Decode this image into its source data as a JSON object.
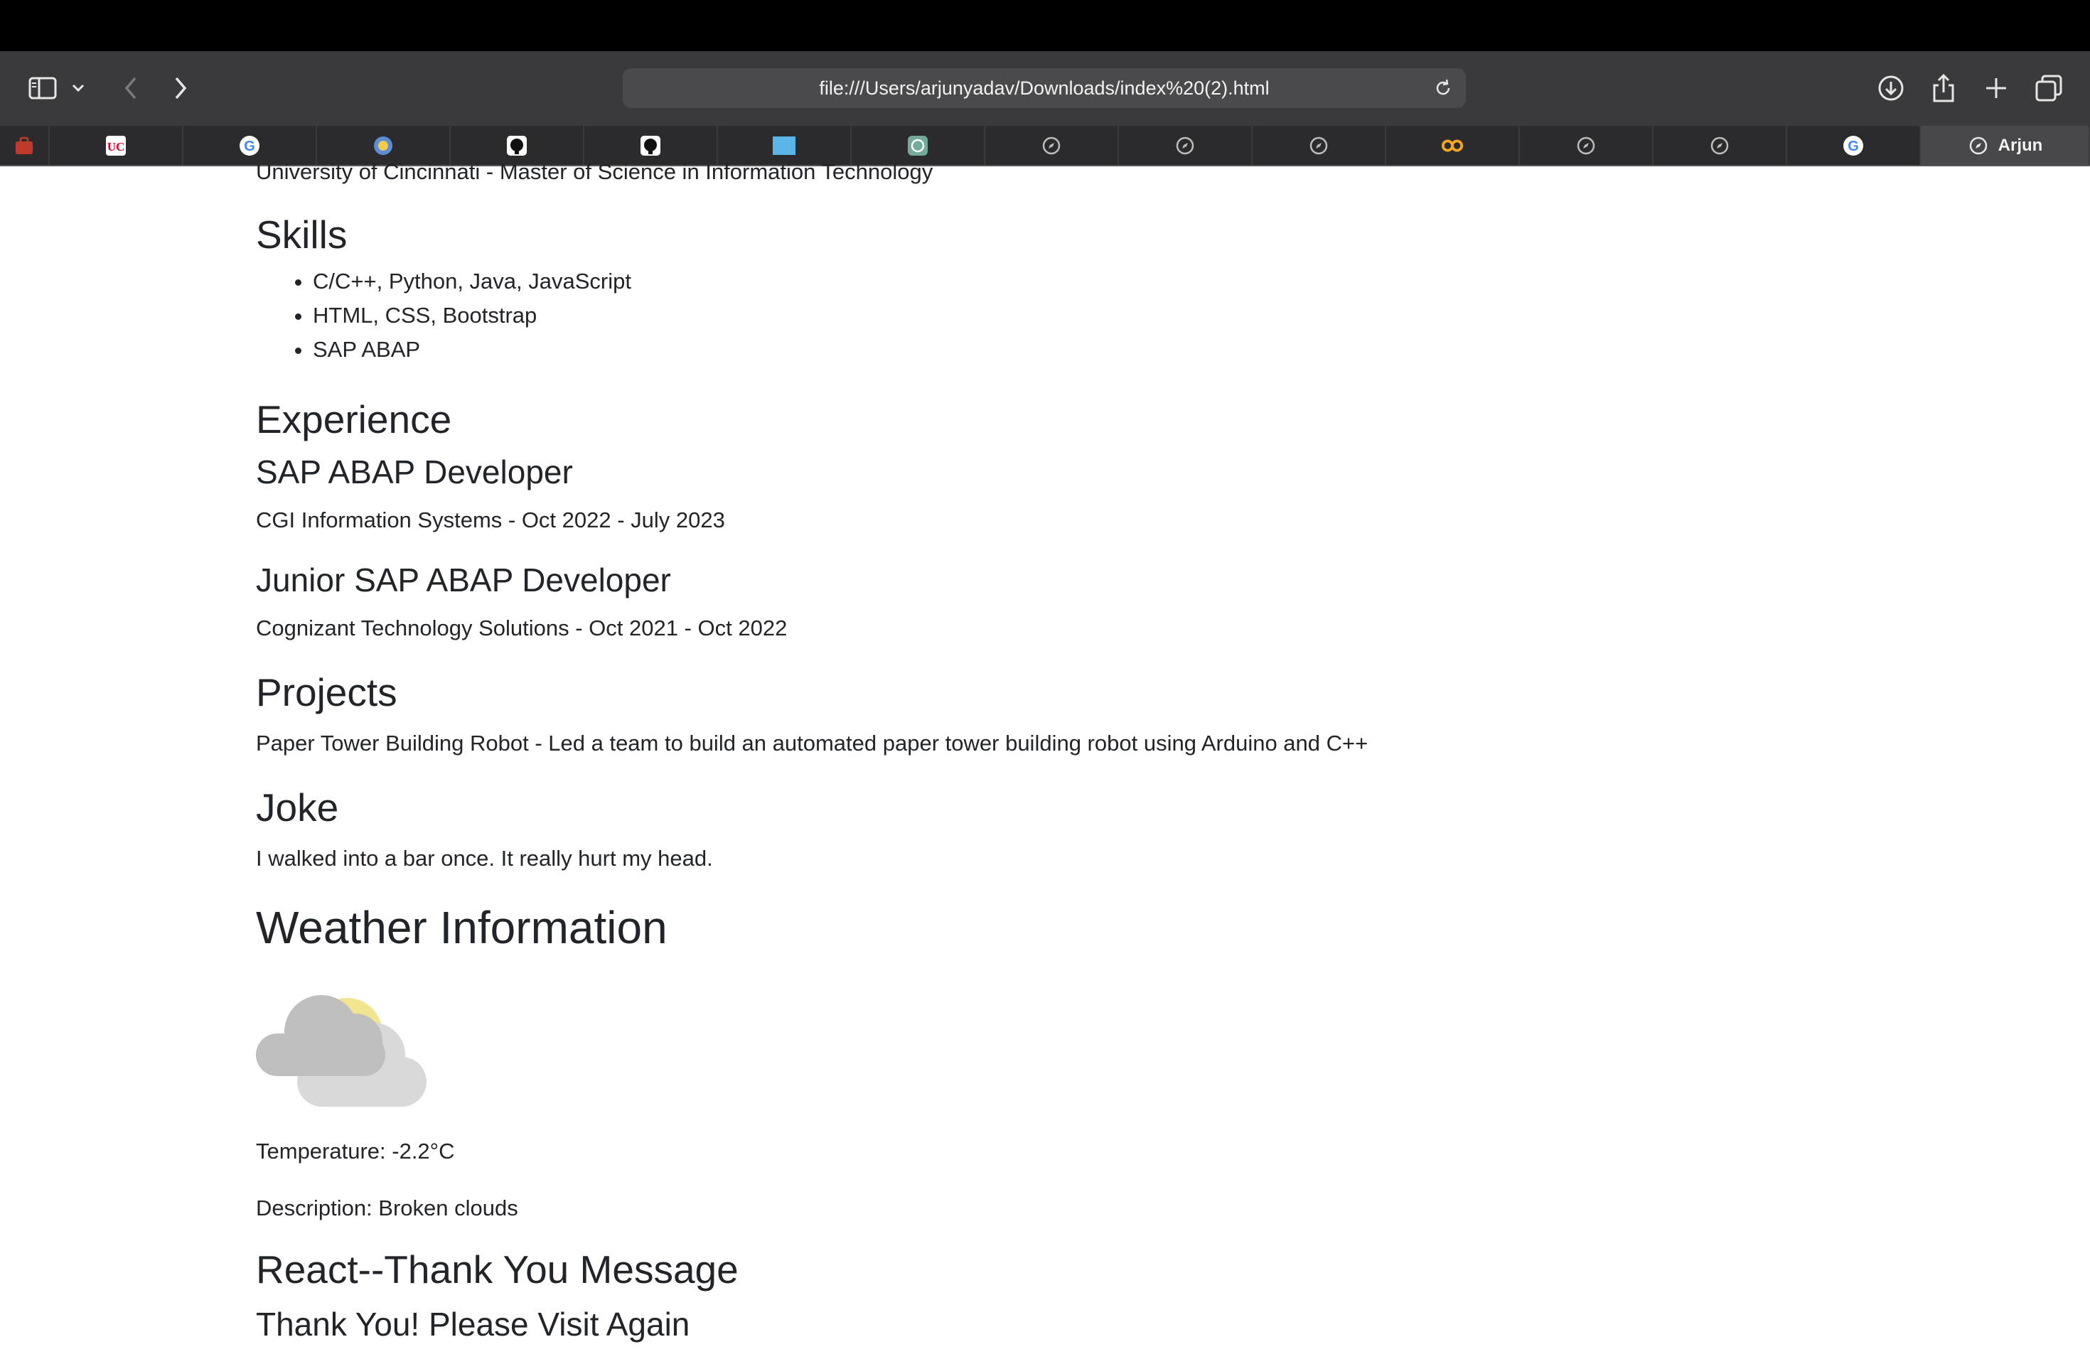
{
  "browser": {
    "url": "file:///Users/arjunyadav/Downloads/index%20(2).html",
    "active_tab_label": "Arjun",
    "tabs": [
      {
        "icon": "bag-icon",
        "color": "#c0392b"
      },
      {
        "icon": "uc-logo-icon",
        "color": "#e00122"
      },
      {
        "icon": "google-icon",
        "color": "#4285f4"
      },
      {
        "icon": "globe-icon",
        "color": "#5a8fd6"
      },
      {
        "icon": "github-icon",
        "color": "#ffffff"
      },
      {
        "icon": "github-icon",
        "color": "#ffffff"
      },
      {
        "icon": "folder-icon",
        "color": "#5ab4e6"
      },
      {
        "icon": "openai-icon",
        "color": "#74aa9c"
      },
      {
        "icon": "compass-icon",
        "color": "#bdbdbd"
      },
      {
        "icon": "compass-icon",
        "color": "#bdbdbd"
      },
      {
        "icon": "compass-icon",
        "color": "#bdbdbd"
      },
      {
        "icon": "infinity-icon",
        "color": "#f5a623"
      },
      {
        "icon": "compass-icon",
        "color": "#bdbdbd"
      },
      {
        "icon": "compass-icon",
        "color": "#bdbdbd"
      },
      {
        "icon": "google-icon",
        "color": "#4285f4"
      }
    ]
  },
  "page": {
    "education_line": "University of Cincinnati - Master of Science in Information Technology",
    "skills_heading": "Skills",
    "skills": [
      "C/C++, Python, Java, JavaScript",
      "HTML, CSS, Bootstrap",
      "SAP ABAP"
    ],
    "experience_heading": "Experience",
    "jobs": [
      {
        "title": "SAP ABAP Developer",
        "detail": "CGI Information Systems - Oct 2022 - July 2023"
      },
      {
        "title": "Junior SAP ABAP Developer",
        "detail": "Cognizant Technology Solutions - Oct 2021 - Oct 2022"
      }
    ],
    "projects_heading": "Projects",
    "project_text": "Paper Tower Building Robot - Led a team to build an automated paper tower building robot using Arduino and C++",
    "joke_heading": "Joke",
    "joke_text": "I walked into a bar once. It really hurt my head.",
    "weather_heading": "Weather Information",
    "weather_icon": "broken-clouds-icon",
    "temperature_text": "Temperature: -2.2°C",
    "description_text": "Description: Broken clouds",
    "react_heading": "React--Thank You Message",
    "thank_you_text": "Thank You! Please Visit Again"
  }
}
